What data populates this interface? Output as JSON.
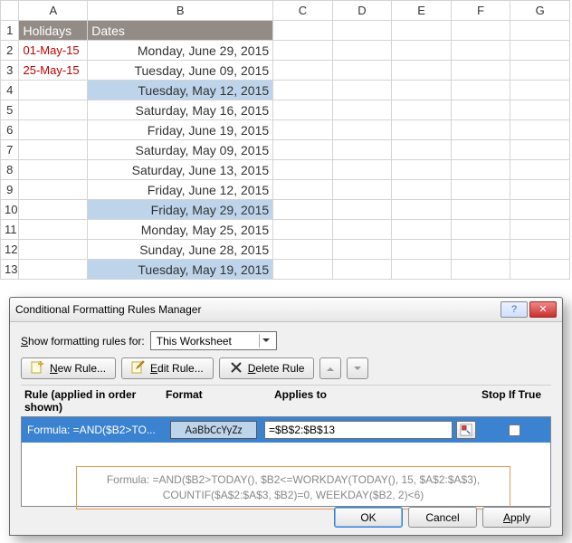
{
  "columns": [
    "A",
    "B",
    "C",
    "D",
    "E",
    "F",
    "G"
  ],
  "header": {
    "A": "Holidays",
    "B": "Dates"
  },
  "holidays": {
    "r2": "01-May-15",
    "r3": "25-May-15"
  },
  "dates": {
    "r2": "Monday, June 29, 2015",
    "r3": "Tuesday, June 09, 2015",
    "r4": "Tuesday, May 12, 2015",
    "r5": "Saturday, May 16, 2015",
    "r6": "Friday, June 19, 2015",
    "r7": "Saturday, May 09, 2015",
    "r8": "Saturday, June 13, 2015",
    "r9": "Friday, June 12, 2015",
    "r10": "Friday, May 29, 2015",
    "r11": "Monday, May 25, 2015",
    "r12": "Sunday, June 28, 2015",
    "r13": "Tuesday, May 19, 2015"
  },
  "highlight_rows": [
    4,
    10,
    13
  ],
  "dialog": {
    "title": "Conditional Formatting Rules Manager",
    "show_label_pre": "S",
    "show_label_post": "how formatting rules for:",
    "show_value": "This Worksheet",
    "buttons": {
      "new": "New Rule...",
      "edit": "Edit Rule...",
      "del": "Delete Rule"
    },
    "list_headers": {
      "rule": "Rule (applied in order shown)",
      "format": "Format",
      "applies": "Applies to",
      "stop": "Stop If True"
    },
    "rule1": {
      "name": "Formula: =AND($B2>TO...",
      "preview": "AaBbCcYyZz",
      "applies": "=$B$2:$B$13"
    },
    "formula_l1": "Formula: =AND($B2>TODAY(), $B2<=WORKDAY(TODAY(), 15, $A$2:$A$3),",
    "formula_l2": "COUNTIF($A$2:$A$3, $B2)=0, WEEKDAY($B2, 2)<6)",
    "ok": "OK",
    "cancel": "Cancel",
    "apply_pre": "A",
    "apply_post": "pply",
    "help": "?",
    "close": "✕"
  }
}
